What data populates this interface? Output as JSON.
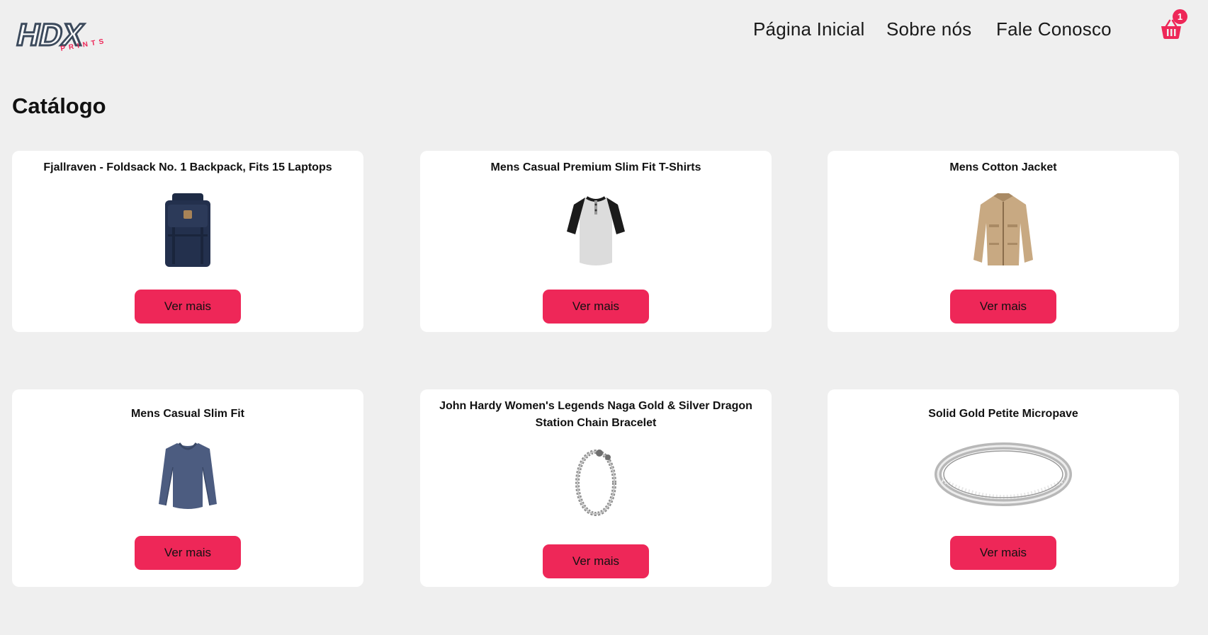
{
  "brand": {
    "logo_main": "HDX",
    "logo_sub": "PRINTS",
    "accent_color": "#ee2758",
    "logo_dark_color": "#3c4a5c"
  },
  "nav": {
    "items": [
      {
        "label": "Página Inicial"
      },
      {
        "label": "Sobre nós"
      },
      {
        "label": "Fale Conosco"
      }
    ],
    "cart_icon": "basket-icon",
    "cart_count": "1"
  },
  "page": {
    "title": "Catálogo"
  },
  "products": [
    {
      "title": "Fjallraven - Foldsack No. 1 Backpack, Fits 15 Laptops",
      "image": "backpack-image",
      "button": "Ver mais"
    },
    {
      "title": "Mens Casual Premium Slim Fit T-Shirts",
      "image": "tshirt-image",
      "button": "Ver mais"
    },
    {
      "title": "Mens Cotton Jacket",
      "image": "jacket-image",
      "button": "Ver mais"
    },
    {
      "title": "Mens Casual Slim Fit",
      "image": "longsleeve-image",
      "button": "Ver mais"
    },
    {
      "title": "John Hardy Women's Legends Naga Gold & Silver Dragon Station Chain Bracelet",
      "image": "bracelet-image",
      "button": "Ver mais"
    },
    {
      "title": "Solid Gold Petite Micropave",
      "image": "ring-image",
      "button": "Ver mais"
    }
  ]
}
